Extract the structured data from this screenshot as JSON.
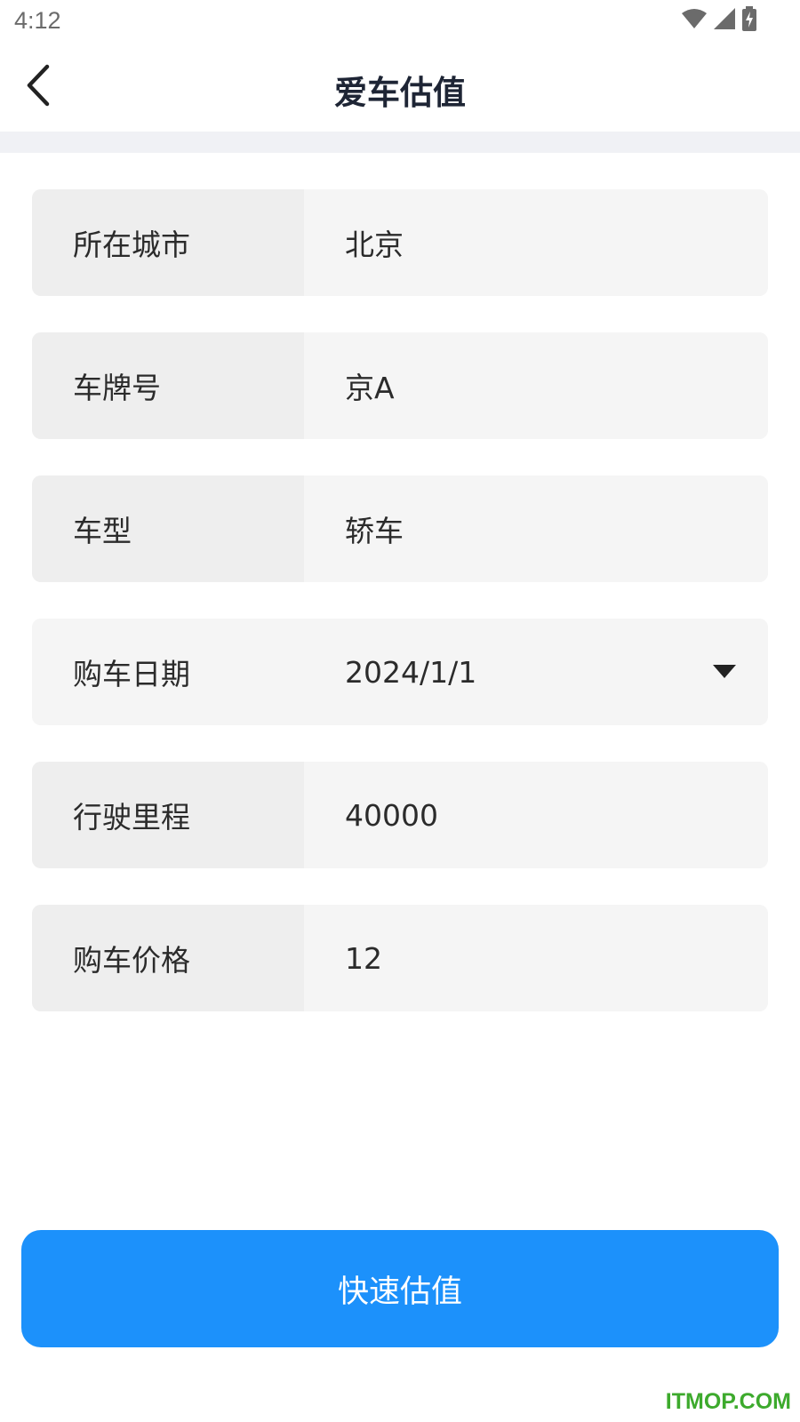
{
  "status_bar": {
    "time": "4:12",
    "icons": [
      "wifi-icon",
      "cellular-signal-icon",
      "battery-charging-icon"
    ]
  },
  "header": {
    "back_icon": "chevron-left-icon",
    "title": "爱车估值"
  },
  "form": {
    "rows": [
      {
        "label": "所在城市",
        "value": "北京"
      },
      {
        "label": "车牌号",
        "value": "京A"
      },
      {
        "label": "车型",
        "value": "轿车"
      },
      {
        "label": "购车日期",
        "value": "2024/1/1",
        "control": "dropdown"
      },
      {
        "label": "行驶里程",
        "value": "40000"
      },
      {
        "label": "购车价格",
        "value": "12"
      }
    ]
  },
  "submit": {
    "label": "快速估值"
  },
  "watermark": "ITMOP.COM",
  "colors": {
    "primary": "#1c91fb",
    "title_text": "#1e2535",
    "label_cell_bg": "#eeeeee",
    "value_cell_bg": "#f5f5f5",
    "watermark": "#3daa2d"
  }
}
